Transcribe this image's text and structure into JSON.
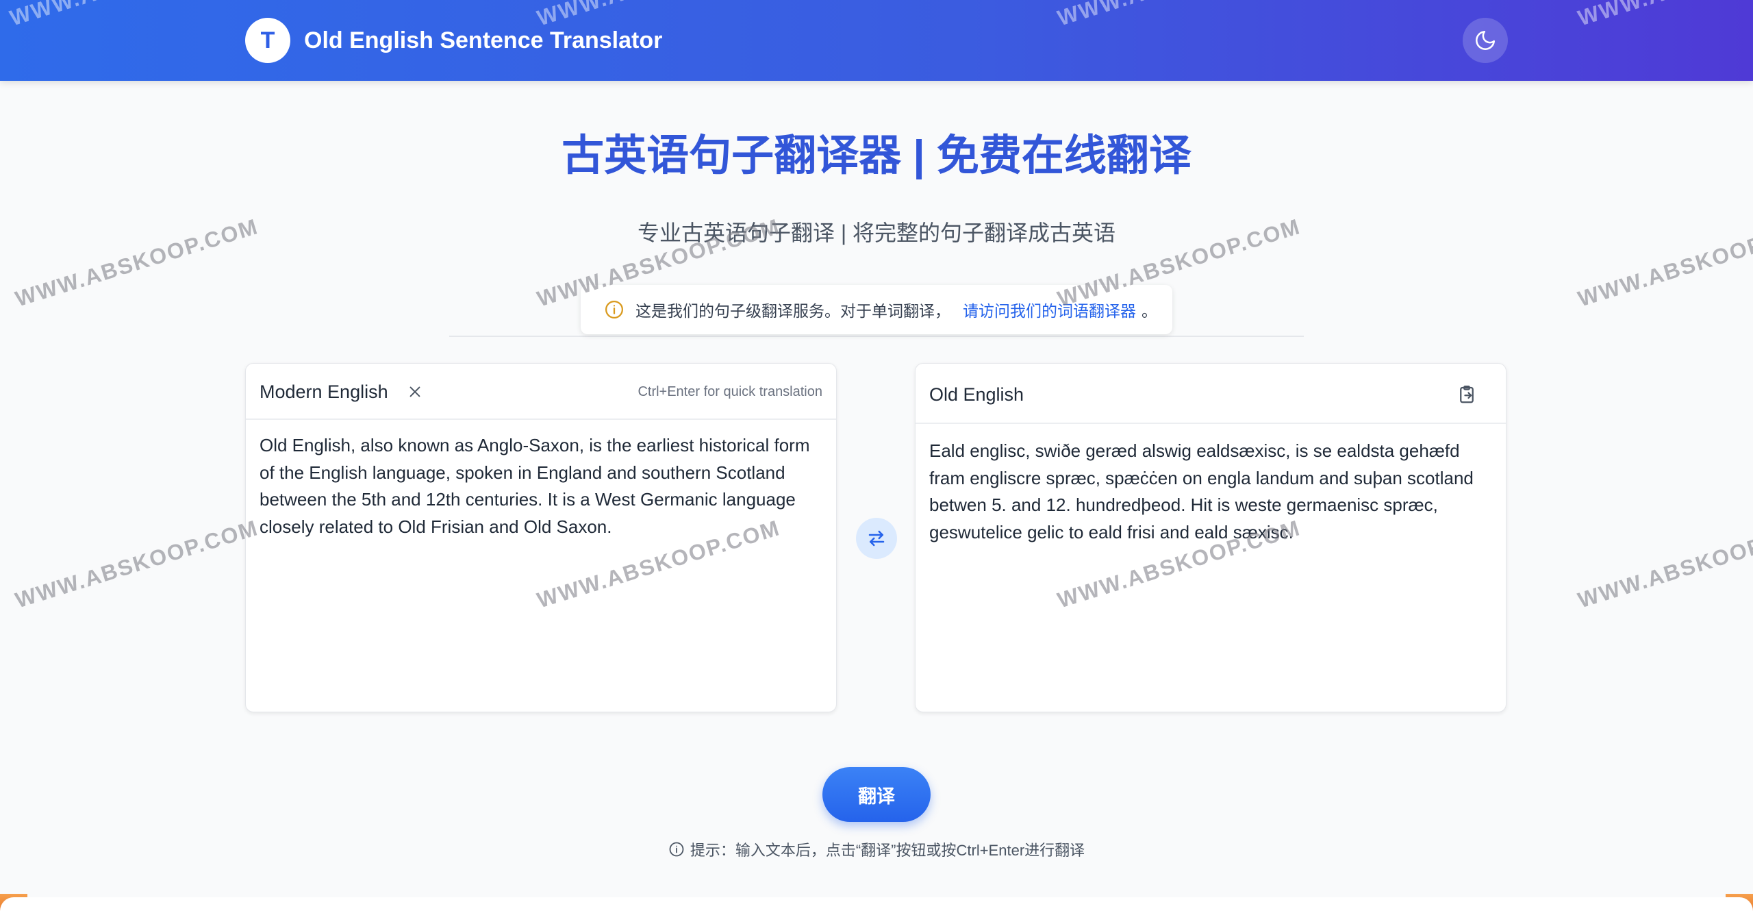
{
  "header": {
    "logo_letter": "T",
    "title": "Old English Sentence Translator",
    "theme_icon": "moon-icon"
  },
  "main": {
    "title": "古英语句子翻译器 | 免费在线翻译",
    "subtitle": "专业古英语句子翻译 | 将完整的句子翻译成古英语"
  },
  "notice": {
    "text": "这是我们的句子级翻译服务。对于单词翻译，",
    "link": "请访问我们的词语翻译器",
    "suffix": "。"
  },
  "source_panel": {
    "label": "Modern English",
    "shortcut_hint": "Ctrl+Enter for quick translation",
    "text": "Old English, also known as Anglo-Saxon, is the earliest historical form of the English language, spoken in England and southern Scotland between the 5th and 12th centuries. It is a West Germanic language closely related to Old Frisian and Old Saxon."
  },
  "target_panel": {
    "label": "Old English",
    "text": "Eald englisc, swiðe geræd alswig ealdsæxisc, is se ealdsta gehæfd fram engliscre spræc, spæċċen on engla landum and suþan scotland betwen 5. and 12. hundredþeod. Hit is weste germaenisc spræc, geswutelice gelic to eald frisi and eald sæxisc."
  },
  "actions": {
    "translate_label": "翻译"
  },
  "tip": {
    "text": "提示：输入文本后，点击“翻译”按钮或按Ctrl+Enter进行翻译"
  },
  "watermark": "WWW.ABSKOOP.COM",
  "colors": {
    "accent": "#3256d8",
    "link": "#2563eb",
    "header_start": "#2f6bea",
    "header_end": "#4f3ad6"
  }
}
